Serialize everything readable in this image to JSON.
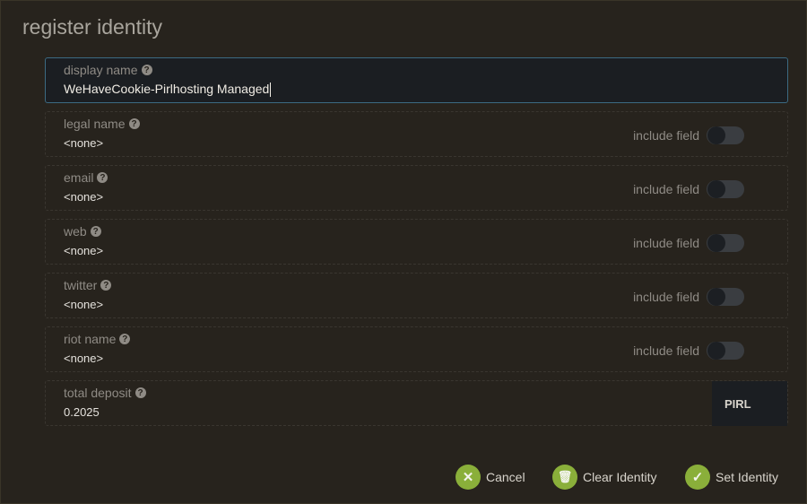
{
  "title": "register identity",
  "fields": [
    {
      "label": "display name",
      "value": "WeHaveCookie-Pirlhosting Managed"
    },
    {
      "label": "legal name",
      "value": "<none>",
      "toggle": "include field"
    },
    {
      "label": "email",
      "value": "<none>",
      "toggle": "include field"
    },
    {
      "label": "web",
      "value": "<none>",
      "toggle": "include field"
    },
    {
      "label": "twitter",
      "value": "<none>",
      "toggle": "include field"
    },
    {
      "label": "riot name",
      "value": "<none>",
      "toggle": "include field"
    }
  ],
  "deposit": {
    "label": "total deposit",
    "value": "0.2025",
    "unit": "PIRL"
  },
  "buttons": {
    "cancel": "Cancel",
    "clear": "Clear Identity",
    "set": "Set Identity"
  },
  "icons": {
    "help": "?",
    "cancel": "✕",
    "clear": "🗑",
    "set": "✓"
  },
  "toggles_enabled": [
    false,
    false,
    false,
    false,
    false
  ],
  "colors": {
    "accent": "#8aaf3a",
    "active_border": "#3c6a82"
  }
}
